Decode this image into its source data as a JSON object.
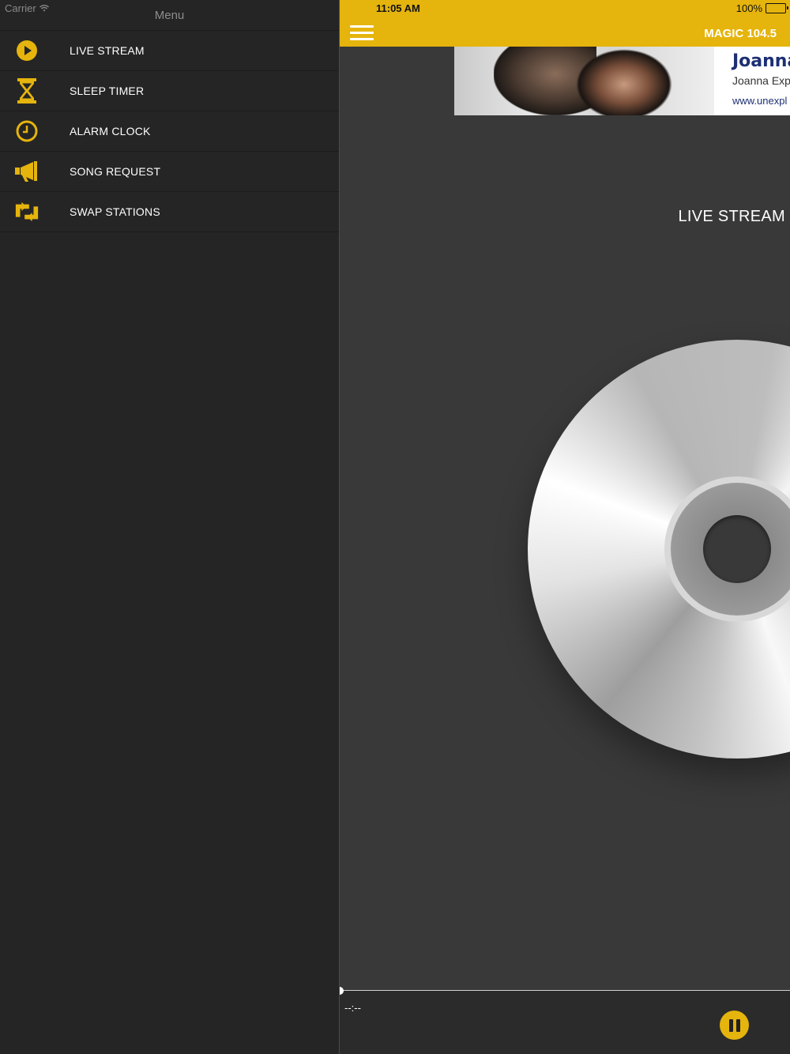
{
  "status": {
    "carrier": "Carrier",
    "time": "11:05 AM",
    "battery": "100%"
  },
  "menu": {
    "title": "Menu",
    "items": [
      {
        "label": "LIVE STREAM",
        "icon": "play-circle-icon"
      },
      {
        "label": "SLEEP TIMER",
        "icon": "hourglass-icon"
      },
      {
        "label": "ALARM CLOCK",
        "icon": "clock-icon"
      },
      {
        "label": "SONG REQUEST",
        "icon": "megaphone-icon"
      },
      {
        "label": "SWAP STATIONS",
        "icon": "swap-arrows-icon"
      }
    ]
  },
  "navbar": {
    "station": "MAGIC 104.5"
  },
  "ad": {
    "title": "Joanna",
    "subtitle": "Joanna Expl",
    "url": "www.unexpl"
  },
  "player": {
    "section_title": "LIVE STREAM",
    "elapsed": "--:--",
    "progress": 0
  },
  "colors": {
    "accent": "#e5b40d",
    "menu_bg": "#252525",
    "main_bg": "#393939"
  }
}
